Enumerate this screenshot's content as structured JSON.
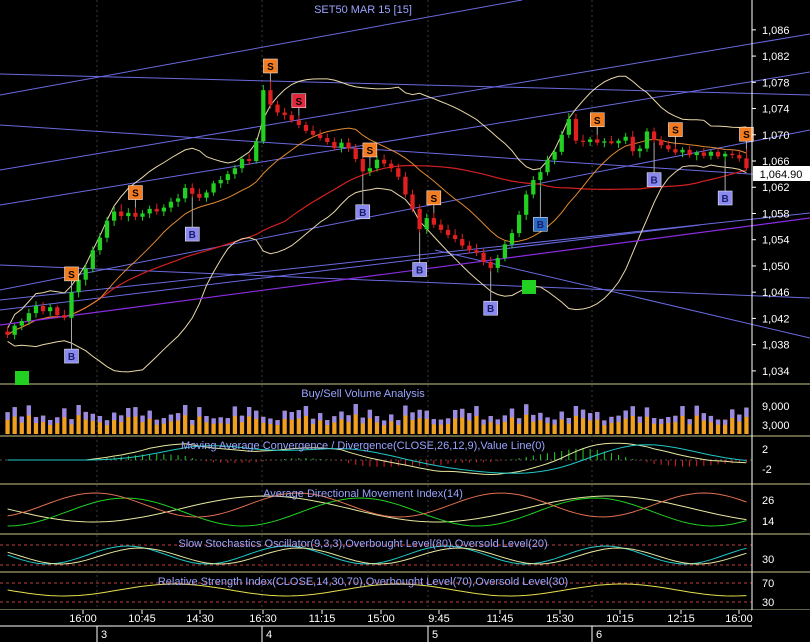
{
  "chart_data": {
    "type": "candlestick",
    "title": "SET50 MAR 15  [15]",
    "last_price": "1,064.90",
    "price_axis_ticks": [
      "1,086",
      "1,082",
      "1,078",
      "1,074",
      "1,070",
      "1,066",
      "1,062",
      "1,058",
      "1,054",
      "1,050",
      "1,046",
      "1,042",
      "1,038",
      "1,034"
    ],
    "time_ticks": [
      "16:00",
      "10:45",
      "14:30",
      "16:30",
      "11:15",
      "15:00",
      "9:45",
      "11:45",
      "15:30",
      "10:15",
      "12:15",
      "16:00"
    ],
    "date_ticks": [
      "3",
      "4",
      "5",
      "6"
    ],
    "candles": [
      [
        1040.0,
        1040.8,
        1039.0,
        1039.5
      ],
      [
        1039.5,
        1041.2,
        1038.8,
        1040.9
      ],
      [
        1040.9,
        1042.0,
        1040.2,
        1041.6
      ],
      [
        1041.6,
        1043.5,
        1041.0,
        1042.8
      ],
      [
        1042.8,
        1044.6,
        1042.1,
        1043.9
      ],
      [
        1043.9,
        1044.5,
        1042.6,
        1043.1
      ],
      [
        1043.1,
        1044.2,
        1042.4,
        1043.7
      ],
      [
        1043.7,
        1044.0,
        1042.0,
        1042.5
      ],
      [
        1042.5,
        1043.3,
        1041.7,
        1042.1
      ],
      [
        1042.1,
        1046.5,
        1041.9,
        1046.0
      ],
      [
        1046.0,
        1048.5,
        1045.2,
        1047.9
      ],
      [
        1047.9,
        1050.3,
        1047.0,
        1049.6
      ],
      [
        1049.6,
        1053.0,
        1049.0,
        1052.4
      ],
      [
        1052.4,
        1055.0,
        1051.7,
        1054.3
      ],
      [
        1054.3,
        1057.5,
        1053.6,
        1056.9
      ],
      [
        1056.9,
        1059.0,
        1056.1,
        1058.3
      ],
      [
        1058.3,
        1059.4,
        1057.0,
        1057.6
      ],
      [
        1057.6,
        1058.8,
        1056.8,
        1058.1
      ],
      [
        1058.1,
        1058.9,
        1057.0,
        1057.5
      ],
      [
        1057.5,
        1058.5,
        1056.9,
        1058.0
      ],
      [
        1058.0,
        1059.2,
        1057.3,
        1058.7
      ],
      [
        1058.7,
        1059.5,
        1057.8,
        1058.3
      ],
      [
        1058.3,
        1059.4,
        1057.6,
        1058.9
      ],
      [
        1058.9,
        1060.4,
        1058.2,
        1059.8
      ],
      [
        1059.8,
        1061.0,
        1059.0,
        1060.3
      ],
      [
        1060.3,
        1062.5,
        1059.7,
        1061.9
      ],
      [
        1061.9,
        1062.6,
        1060.5,
        1061.0
      ],
      [
        1061.0,
        1061.8,
        1059.9,
        1060.4
      ],
      [
        1060.4,
        1061.6,
        1059.8,
        1061.2
      ],
      [
        1061.2,
        1063.0,
        1060.7,
        1062.6
      ],
      [
        1062.6,
        1063.7,
        1061.9,
        1063.1
      ],
      [
        1063.1,
        1064.5,
        1062.5,
        1064.0
      ],
      [
        1064.0,
        1065.4,
        1063.3,
        1064.9
      ],
      [
        1064.9,
        1066.8,
        1064.2,
        1066.3
      ],
      [
        1066.3,
        1067.1,
        1065.4,
        1066.0
      ],
      [
        1066.0,
        1069.5,
        1065.6,
        1069.0
      ],
      [
        1069.0,
        1077.6,
        1068.6,
        1076.8
      ],
      [
        1076.8,
        1078.2,
        1074.0,
        1074.6
      ],
      [
        1074.6,
        1075.2,
        1072.9,
        1073.4
      ],
      [
        1073.4,
        1074.1,
        1072.3,
        1073.0
      ],
      [
        1073.0,
        1073.6,
        1071.8,
        1072.2
      ],
      [
        1072.2,
        1072.9,
        1071.0,
        1071.5
      ],
      [
        1071.5,
        1072.0,
        1070.2,
        1070.6
      ],
      [
        1070.6,
        1071.4,
        1069.7,
        1070.0
      ],
      [
        1070.0,
        1070.8,
        1069.1,
        1069.5
      ],
      [
        1069.5,
        1070.2,
        1068.5,
        1068.9
      ],
      [
        1068.9,
        1069.6,
        1067.6,
        1068.0
      ],
      [
        1068.0,
        1069.4,
        1067.3,
        1068.8
      ],
      [
        1068.8,
        1069.5,
        1067.4,
        1067.9
      ],
      [
        1067.9,
        1068.6,
        1065.8,
        1066.3
      ],
      [
        1066.3,
        1067.4,
        1063.9,
        1064.4
      ],
      [
        1064.4,
        1065.4,
        1063.7,
        1064.9
      ],
      [
        1064.9,
        1066.8,
        1064.4,
        1066.2
      ],
      [
        1066.2,
        1067.0,
        1065.1,
        1065.6
      ],
      [
        1065.6,
        1066.2,
        1064.3,
        1064.9
      ],
      [
        1064.9,
        1065.6,
        1063.1,
        1063.6
      ],
      [
        1063.6,
        1064.3,
        1060.4,
        1060.9
      ],
      [
        1060.9,
        1061.6,
        1058.2,
        1058.7
      ],
      [
        1058.7,
        1059.4,
        1055.1,
        1055.6
      ],
      [
        1055.6,
        1058.0,
        1054.9,
        1057.3
      ],
      [
        1057.3,
        1058.1,
        1055.8,
        1056.3
      ],
      [
        1056.3,
        1057.1,
        1055.0,
        1055.5
      ],
      [
        1055.5,
        1056.3,
        1054.2,
        1054.7
      ],
      [
        1054.7,
        1055.6,
        1053.6,
        1054.1
      ],
      [
        1054.1,
        1054.9,
        1052.6,
        1053.1
      ],
      [
        1053.1,
        1053.8,
        1051.9,
        1052.4
      ],
      [
        1052.4,
        1053.4,
        1051.5,
        1052.0
      ],
      [
        1052.0,
        1052.6,
        1050.1,
        1050.6
      ],
      [
        1050.6,
        1051.4,
        1049.2,
        1049.7
      ],
      [
        1049.7,
        1051.7,
        1049.0,
        1051.2
      ],
      [
        1051.2,
        1053.8,
        1050.7,
        1053.3
      ],
      [
        1053.3,
        1055.6,
        1052.7,
        1055.0
      ],
      [
        1055.0,
        1058.4,
        1054.4,
        1057.8
      ],
      [
        1057.8,
        1061.5,
        1057.0,
        1060.9
      ],
      [
        1060.9,
        1063.7,
        1060.3,
        1063.1
      ],
      [
        1063.1,
        1064.9,
        1062.0,
        1064.3
      ],
      [
        1064.3,
        1066.8,
        1063.8,
        1066.2
      ],
      [
        1066.2,
        1067.9,
        1065.5,
        1067.4
      ],
      [
        1067.4,
        1070.6,
        1066.9,
        1070.0
      ],
      [
        1070.0,
        1073.3,
        1069.5,
        1072.4
      ],
      [
        1072.4,
        1073.2,
        1068.6,
        1069.1
      ],
      [
        1069.1,
        1070.0,
        1068.2,
        1068.9
      ],
      [
        1068.9,
        1069.7,
        1068.3,
        1069.3
      ],
      [
        1069.3,
        1070.0,
        1068.4,
        1068.8
      ],
      [
        1068.8,
        1069.5,
        1068.1,
        1069.0
      ],
      [
        1069.0,
        1069.8,
        1068.5,
        1068.7
      ],
      [
        1068.7,
        1069.4,
        1068.0,
        1069.1
      ],
      [
        1069.1,
        1070.3,
        1068.6,
        1069.7
      ],
      [
        1069.7,
        1070.6,
        1066.8,
        1067.5
      ],
      [
        1067.5,
        1068.4,
        1066.5,
        1067.9
      ],
      [
        1067.9,
        1071.0,
        1067.4,
        1070.5
      ],
      [
        1070.5,
        1071.1,
        1068.8,
        1069.2
      ],
      [
        1069.2,
        1069.8,
        1067.9,
        1068.4
      ],
      [
        1068.4,
        1069.1,
        1067.4,
        1067.8
      ],
      [
        1067.8,
        1068.5,
        1066.9,
        1067.3
      ],
      [
        1067.3,
        1068.1,
        1066.6,
        1067.7
      ],
      [
        1067.7,
        1068.3,
        1066.5,
        1066.9
      ],
      [
        1066.9,
        1067.6,
        1066.1,
        1067.3
      ],
      [
        1067.3,
        1068.0,
        1066.4,
        1066.8
      ],
      [
        1066.8,
        1067.7,
        1066.2,
        1067.4
      ],
      [
        1067.4,
        1067.9,
        1066.3,
        1066.7
      ],
      [
        1066.7,
        1067.5,
        1066.0,
        1067.1
      ],
      [
        1067.1,
        1067.7,
        1066.4,
        1066.9
      ],
      [
        1066.9,
        1067.6,
        1065.9,
        1066.4
      ],
      [
        1066.4,
        1067.8,
        1064.5,
        1064.9
      ]
    ],
    "signals": [
      {
        "type": "S",
        "candle": 9,
        "color": "#f47c20"
      },
      {
        "type": "B",
        "candle": 9,
        "color": "#8a8aee"
      },
      {
        "type": "S",
        "candle": 18,
        "color": "#f47c20"
      },
      {
        "type": "B",
        "candle": 26,
        "color": "#8a8aee"
      },
      {
        "type": "S",
        "candle": 37,
        "color": "#f47c20"
      },
      {
        "type": "S",
        "candle": 41,
        "color": "#e0283c"
      },
      {
        "type": "S",
        "candle": 51,
        "color": "#f47c20"
      },
      {
        "type": "B",
        "candle": 50,
        "color": "#8a8aee"
      },
      {
        "type": "S",
        "candle": 60,
        "color": "#f47c20"
      },
      {
        "type": "B",
        "candle": 58,
        "color": "#8a8aee"
      },
      {
        "type": "B",
        "candle": 68,
        "color": "#8a8aee"
      },
      {
        "type": "B",
        "candle": 75,
        "color": "#2a6cc4"
      },
      {
        "type": "S",
        "candle": 83,
        "color": "#f47c20"
      },
      {
        "type": "B",
        "candle": 91,
        "color": "#8a8aee"
      },
      {
        "type": "S",
        "candle": 94,
        "color": "#f47c20"
      },
      {
        "type": "B",
        "candle": 101,
        "color": "#8a8aee"
      },
      {
        "type": "S",
        "candle": 104,
        "color": "#f47c20"
      }
    ],
    "panels": [
      {
        "title": "Buy/Sell Volume Analysis",
        "ticks": [
          "9,000",
          "3,000"
        ]
      },
      {
        "title": "Moving Average Convergence / Divergence(CLOSE,26,12,9),Value Line(0)",
        "ticks": [
          "2",
          "-2"
        ]
      },
      {
        "title": "Average Directional Movement Index(14)",
        "ticks": [
          "26",
          "14"
        ]
      },
      {
        "title": "Slow Stochastics Oscillator(9,3,3),Overbought Level(80),Oversold Level(20)",
        "ticks": [
          "30"
        ]
      },
      {
        "title": "Relative Strength Index(CLOSE,14,30,70),Overbought Level(70),Oversold Level(30)",
        "ticks": [
          "70",
          "30"
        ]
      }
    ]
  }
}
